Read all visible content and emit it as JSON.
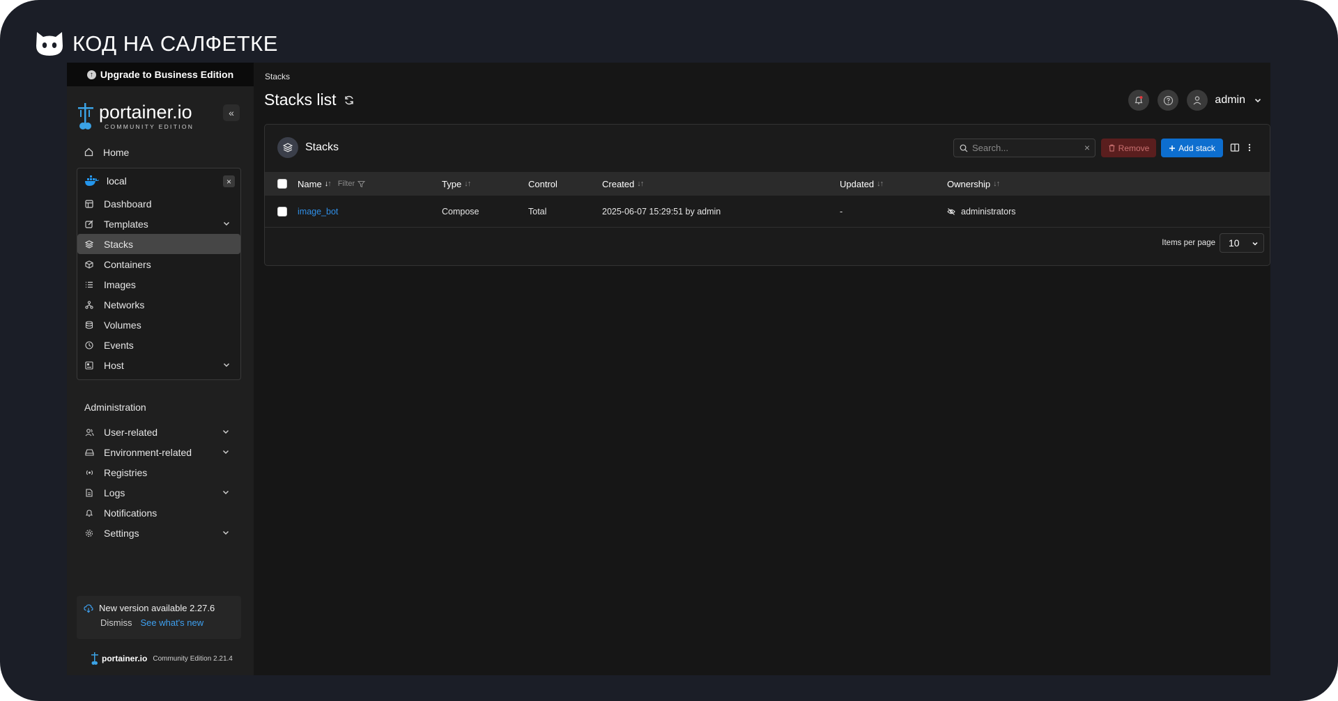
{
  "brand": {
    "text": "КОД НА САЛФЕТКЕ"
  },
  "sidebar": {
    "upgrade_label": "Upgrade to Business Edition",
    "logo": {
      "name": "portainer.io",
      "edition": "COMMUNITY EDITION"
    },
    "collapse_label": "«",
    "home": "Home",
    "environment": {
      "name": "local",
      "close": "×",
      "items": [
        {
          "label": "Dashboard",
          "icon": "dashboard-icon"
        },
        {
          "label": "Templates",
          "icon": "edit-icon",
          "expandable": true
        },
        {
          "label": "Stacks",
          "icon": "layers-icon",
          "active": true
        },
        {
          "label": "Containers",
          "icon": "box-icon"
        },
        {
          "label": "Images",
          "icon": "list-icon"
        },
        {
          "label": "Networks",
          "icon": "network-icon"
        },
        {
          "label": "Volumes",
          "icon": "database-icon"
        },
        {
          "label": "Events",
          "icon": "clock-icon"
        },
        {
          "label": "Host",
          "icon": "host-icon",
          "expandable": true
        }
      ]
    },
    "admin_title": "Administration",
    "admin_items": [
      {
        "label": "User-related",
        "icon": "users-icon",
        "expandable": true
      },
      {
        "label": "Environment-related",
        "icon": "drive-icon",
        "expandable": true
      },
      {
        "label": "Registries",
        "icon": "radio-icon"
      },
      {
        "label": "Logs",
        "icon": "file-icon",
        "expandable": true
      },
      {
        "label": "Notifications",
        "icon": "bell-icon"
      },
      {
        "label": "Settings",
        "icon": "gear-icon",
        "expandable": true
      }
    ],
    "update": {
      "text": "New version available 2.27.6",
      "dismiss": "Dismiss",
      "whats_new": "See what's new"
    },
    "footer": {
      "name": "portainer.io",
      "edition": "Community Edition 2.21.4"
    }
  },
  "main": {
    "breadcrumb": "Stacks",
    "title": "Stacks list",
    "user": "admin",
    "panel": {
      "title": "Stacks",
      "search_placeholder": "Search...",
      "remove_label": "Remove",
      "add_label": "Add stack",
      "columns": {
        "name": "Name",
        "filter": "Filter",
        "type": "Type",
        "control": "Control",
        "created": "Created",
        "updated": "Updated",
        "ownership": "Ownership"
      },
      "rows": [
        {
          "name": "image_bot",
          "type": "Compose",
          "control": "Total",
          "created": "2025-06-07 15:29:51 by admin",
          "updated": "-",
          "ownership": "administrators"
        }
      ],
      "items_per_page_label": "Items per page",
      "items_per_page": "10"
    }
  },
  "colors": {
    "accent": "#0d6ecf",
    "link": "#2f8ee6",
    "danger": "#5a1e1e",
    "frame": "#1b1e27"
  }
}
